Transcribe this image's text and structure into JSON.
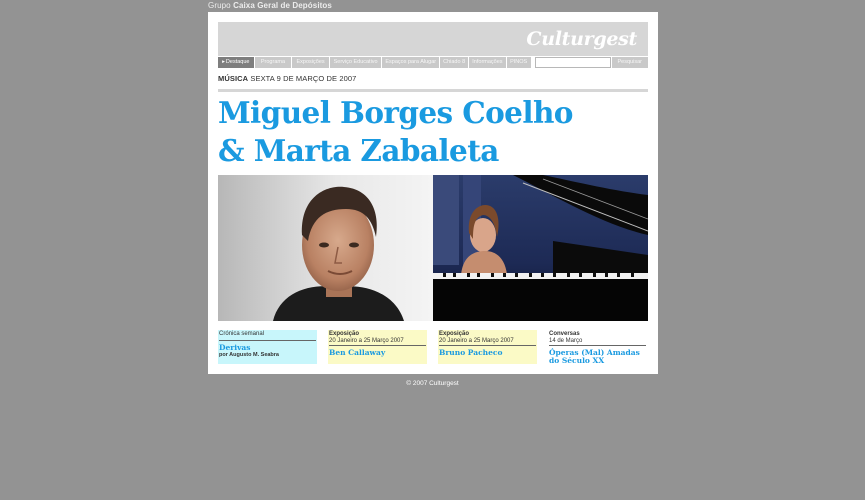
{
  "topbar": {
    "prefix": "Grupo",
    "brand": "Caixa Geral de Depósitos"
  },
  "header": {
    "logo": "Culturgest"
  },
  "nav": {
    "tabs": [
      "Destaque",
      "Programa",
      "Exposições",
      "Serviço Educativo",
      "Espaços para Alugar",
      "Chiado 8",
      "Informações",
      "PINOS"
    ],
    "search_placeholder": "",
    "search_button": "Pesquisar"
  },
  "event": {
    "category": "MÚSICA",
    "date": "SEXTA 9 DE MARÇO DE 2007",
    "title_line1": "Miguel Borges Coelho",
    "title_line2": "& Marta Zabaleta"
  },
  "cards": [
    {
      "kicker": "Crónica semanal",
      "sub": "",
      "head": "Derivas",
      "by": "por Augusto M. Seabra",
      "bg": "#c8f6fb"
    },
    {
      "kicker": "Exposição",
      "sub": "20 Janeiro a 25 Março 2007",
      "head": "Ben Callaway",
      "by": "",
      "bg": "#fbfac6"
    },
    {
      "kicker": "Exposição",
      "sub": "20 Janeiro a 25 Março 2007",
      "head": "Bruno Pacheco",
      "by": "",
      "bg": "#fbfac6"
    },
    {
      "kicker": "Conversas",
      "sub": "14 de Março",
      "head": "Óperas (Mal) Amadas do Século XX",
      "by": "",
      "bg": "#ffffff"
    }
  ],
  "footer": {
    "copyright": "© 2007 Culturgest"
  },
  "colors": {
    "background": "#939393",
    "accent": "#1a9ae0",
    "header_bg": "#d6d6d6"
  }
}
